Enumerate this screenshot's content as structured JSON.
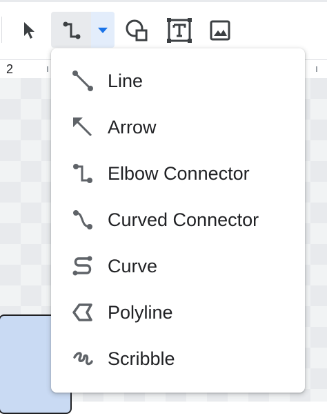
{
  "ruler": {
    "number": "2"
  },
  "toolbar": {
    "tools": [
      {
        "icon": "select-arrow-icon"
      },
      {
        "icon": "elbow-connector-icon"
      },
      {
        "icon": "dropdown-caret-icon"
      },
      {
        "icon": "shape-icon"
      },
      {
        "icon": "text-box-icon"
      },
      {
        "icon": "image-icon"
      }
    ]
  },
  "menu": {
    "items": [
      {
        "label": "Line",
        "icon": "line-icon"
      },
      {
        "label": "Arrow",
        "icon": "arrow-icon"
      },
      {
        "label": "Elbow Connector",
        "icon": "elbow-connector-icon"
      },
      {
        "label": "Curved Connector",
        "icon": "curved-connector-icon"
      },
      {
        "label": "Curve",
        "icon": "curve-icon"
      },
      {
        "label": "Polyline",
        "icon": "polyline-icon"
      },
      {
        "label": "Scribble",
        "icon": "scribble-icon"
      }
    ]
  },
  "colors": {
    "icon": "#5f6368",
    "active_caret": "#1a73e8",
    "text": "#202124",
    "shape_fill": "#c9daf3"
  }
}
